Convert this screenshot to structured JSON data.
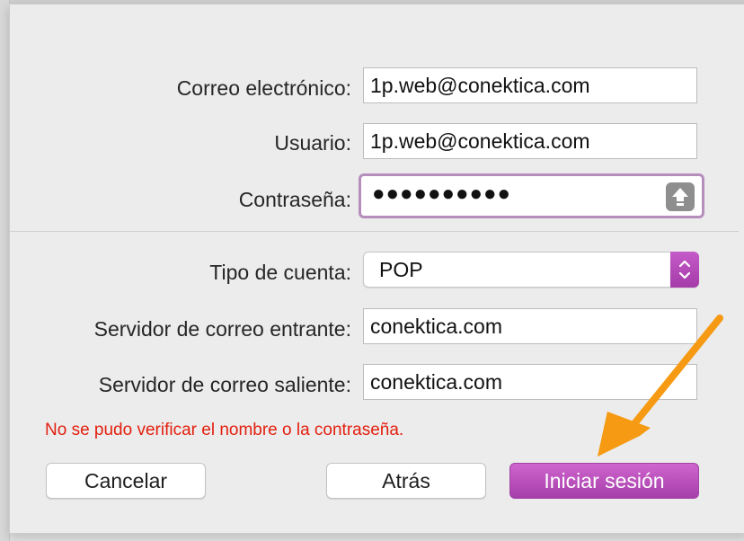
{
  "form": {
    "email": {
      "label": "Correo electrónico:",
      "value": "1p.web@conektica.com"
    },
    "user": {
      "label": "Usuario:",
      "value": "1p.web@conektica.com"
    },
    "password": {
      "label": "Contraseña:",
      "masked_value": "●●●●●●●●●●",
      "icon": "keychain-icon"
    },
    "account_type": {
      "label": "Tipo de cuenta:",
      "selected": "POP"
    },
    "incoming_server": {
      "label": "Servidor de correo entrante:",
      "value": "conektica.com"
    },
    "outgoing_server": {
      "label": "Servidor de correo saliente:",
      "value": "conektica.com"
    }
  },
  "error_message": "No se pudo verificar el nombre o la contraseña.",
  "buttons": {
    "cancel": "Cancelar",
    "back": "Atrás",
    "sign_in": "Iniciar sesión"
  },
  "colors": {
    "accent": "#b04cb3",
    "error": "#e3200f",
    "annotation_arrow": "#f59a12"
  }
}
